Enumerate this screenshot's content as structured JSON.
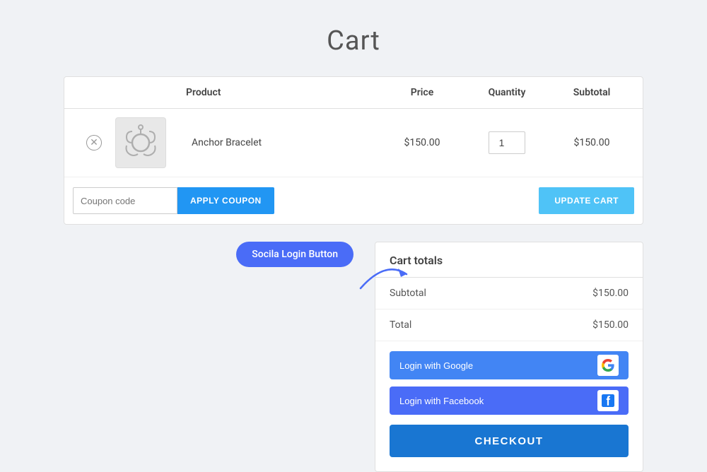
{
  "page": {
    "title": "Cart"
  },
  "cart": {
    "table": {
      "headers": [
        "",
        "",
        "Product",
        "Price",
        "Quantity",
        "Subtotal"
      ],
      "rows": [
        {
          "product_name": "Anchor Bracelet",
          "price": "$150.00",
          "quantity": "1",
          "subtotal": "$150.00"
        }
      ]
    },
    "coupon": {
      "placeholder": "Coupon code",
      "apply_label": "APPLY COUPON",
      "update_label": "UPDATE CART"
    }
  },
  "cart_totals": {
    "title": "Cart totals",
    "subtotal_label": "Subtotal",
    "subtotal_value": "$150.00",
    "total_label": "Total",
    "total_value": "$150.00",
    "google_btn_label": "Login with Google",
    "facebook_btn_label": "Login with Facebook",
    "checkout_label": "CHECKOUT"
  },
  "annotation": {
    "label": "Socila Login Button"
  }
}
